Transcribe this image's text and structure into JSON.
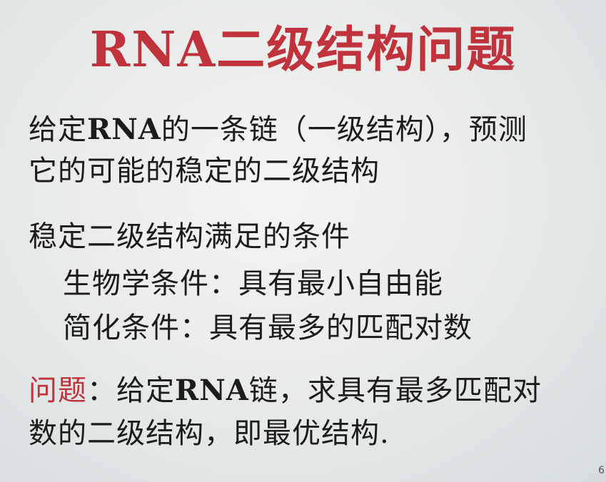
{
  "slide": {
    "title": "RNA二级结构问题",
    "intro_line_1_a": "给定",
    "intro_line_1_b": "RNA",
    "intro_line_1_c": "的一条链（一级结构），预测",
    "intro_line_2": "它的可能的稳定的二级结构",
    "conditions_heading": "稳定二级结构满足的条件",
    "condition_biological": "生物学条件：具有最小自由能",
    "condition_simplified": "简化条件：具有最多的匹配对数",
    "problem_label": "问题",
    "problem_line_1_a": "：给定",
    "problem_line_1_b": "RNA",
    "problem_line_1_c": "链，求具有最多匹配对",
    "problem_line_2": "数的二级结构，即最优结构.",
    "page_number": "6"
  },
  "colors": {
    "title": "#c0333c",
    "problem_label": "#c0333c",
    "body_text": "#1c1c1c"
  }
}
